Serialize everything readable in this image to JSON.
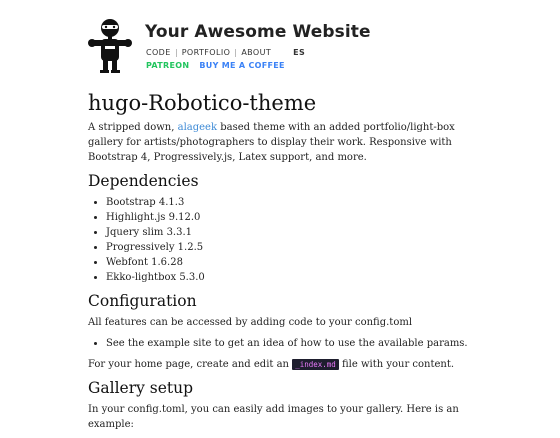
{
  "header": {
    "site_title": "Your Awesome Website",
    "nav": [
      {
        "label": "CODE"
      },
      {
        "label": "PORTFOLIO"
      },
      {
        "label": "ABOUT"
      }
    ],
    "language": "ES",
    "support": {
      "patreon": "PATREON",
      "coffee": "BUY ME A COFFEE"
    },
    "colors": {
      "patreon": "#22c55e",
      "coffee": "#3b82f6"
    }
  },
  "content": {
    "title": "hugo-Robotico-theme",
    "intro": {
      "before": "A stripped down, ",
      "link": "alageek",
      "after": " based theme with an added portfolio/light-box gallery for artists/photographers to display their work. Responsive with Bootstrap 4, Progressively.js, Latex support, and more."
    },
    "dependencies": {
      "heading": "Dependencies",
      "items": [
        "Bootstrap 4.1.3",
        "Highlight.js 9.12.0",
        "Jquery slim 3.3.1",
        "Progressively 1.2.5",
        "Webfont 1.6.28",
        "Ekko-lightbox 5.3.0"
      ]
    },
    "configuration": {
      "heading": "Configuration",
      "text": "All features can be accessed by adding code to your config.toml",
      "bullet": "See the example site to get an idea of how to use the available params.",
      "home": {
        "before": "For your home page, create and edit an ",
        "code": "_index.md",
        "after": " file with your content."
      }
    },
    "gallery": {
      "heading": "Gallery setup",
      "text": "In your config.toml, you can easily add images to your gallery. Here is an example:"
    }
  }
}
